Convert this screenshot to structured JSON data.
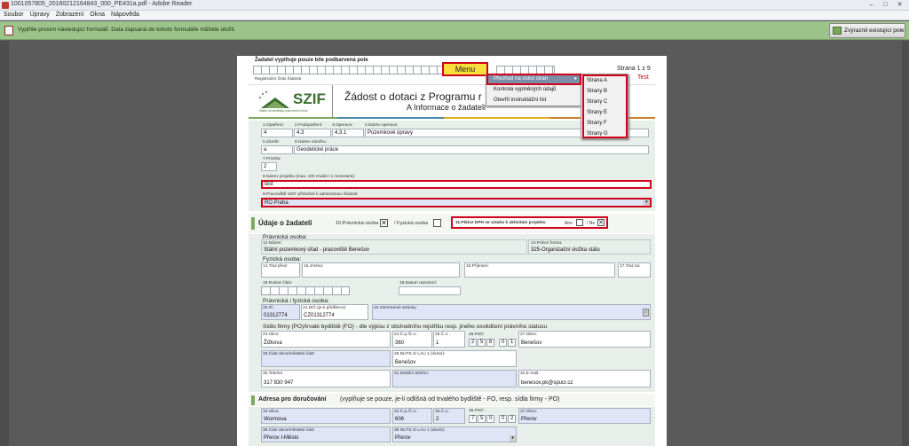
{
  "window": {
    "title": "1001057805_20160212164843_000_PE431a.pdf - Adobe Reader",
    "minimize": "–",
    "maximize": "□",
    "close": "✕"
  },
  "menubar": [
    "Soubor",
    "Úpravy",
    "Zobrazení",
    "Okna",
    "Nápověda"
  ],
  "notification": {
    "text": "Vyplňte prosím následující formulář. Data zapsaná do tohoto formuláře můžete uložit.",
    "highlight_button": "Zvýraznit existující pole"
  },
  "form": {
    "top_note": "Žadatel vyplňuje pouze bíle podbarvená pole",
    "reg_label": "Registrační číslo žádosti",
    "page_label": "Strana 1 z 9",
    "test_label": "Test",
    "menu_button": "Menu",
    "logo_text": "SZIF",
    "logo_sub": "Státní zemědělský intervenční fond",
    "title_line1": "Žádost o dotaci z Programu r",
    "title_line2": "A Informace o žadateli",
    "context_menu": [
      "Přechod na oskci stran",
      "Kontrola vyplněných údajů",
      "Otevřít instruktážní list"
    ],
    "submenu": [
      "Strana A",
      "Strany B",
      "Strany C",
      "Strany E",
      "Strany F",
      "Strany G"
    ],
    "f1_label": "1.Opatření:",
    "f1_value": "4",
    "f2_label": "2.Podopatření:",
    "f2_value": "4.3",
    "f3_label": "3.Operace:",
    "f3_value": "4.3.1",
    "f4_label": "4.Název operace:",
    "f4_value": "Pozemkové úpravy",
    "f5_label": "5.Záměr:",
    "f5_value": "a",
    "f6_label": "6.Název záměru:",
    "f6_value": "Geodetické práce",
    "f7_label": "7.Priorita:",
    "f7_value": "2",
    "f8_label": "8.Název projektu (max. 100 znaků i s mezerami):",
    "f8_value": "test",
    "f9_label": "9.Pracoviště SZIF příslušné k administraci žádosti:",
    "f9_value": "RO Praha",
    "applicant_header": "Údaje o žadateli",
    "f10_label": "10.Právnická osoba",
    "fo_label": "/ Fyzická osoba",
    "f11_label": "11.Plátce DPH ve vztahu k aktivitám projektu",
    "ano": "Ano",
    "ne": "/ Ne",
    "po_header": "Právnická osoba:",
    "f12_label": "12.Název:",
    "f12_value": "Státní pozemkový úřad - pracoviště Benešov",
    "f13_label": "13.Právní forma:",
    "f13_value": "325-Organizační složka státu",
    "fo_header": "Fyzická osoba:",
    "f14_label": "14.Titul před:",
    "f15_label": "15.Jméno:",
    "f16_label": "16.Příjmení:",
    "f17_label": "17.Titul za:",
    "f18_label": "18.Rodné číslo:",
    "f19_label": "19.Datum narození:",
    "pfo_header": "Právnická i fyzická osoba:",
    "f20_label": "20.IČ:",
    "f20_value": "01312774",
    "f21_label": "21.DIČ (je-li přiděleno):",
    "f21_value": "CZ01312774",
    "f22_label": "22.Internetové stránky:",
    "sidlo_header": "Sídlo firmy (PO)/trvalé bydliště (FO) - dle výpisu z obchodního rejstříku resp. jiného osvědčení právního statusu",
    "f23_label": "23.Ulice:",
    "f23_value": "Žižkova",
    "f24_label": "24.Č.p./Č.e.:",
    "f24_value": "360",
    "f25_label": "25.Č.o.:",
    "f25_value": "1",
    "f26_label": "26.PSČ:",
    "f26_digits": [
      "2",
      "5",
      "6",
      "0",
      "1"
    ],
    "f27_label": "27.Obec:",
    "f27_value": "Benešov",
    "f28_label": "28.Část obce/městská část:",
    "f29_label": "29.NUTS 4/ LAU 1 (okres):",
    "f29_value": "Benešov",
    "f30_label": "30.Telefon:",
    "f30_value": "317 830 947",
    "f31_label": "31.Mobilní telefon:",
    "f32_label": "32.E-mail:",
    "f32_value": "benesov.pk@spucr.cz",
    "addr_header": "Adresa pro doručování",
    "addr_note": "(vyplňuje se pouze, je-li odlišná od trvalého bydliště - FO, resp. sídla firmy - PO)",
    "f33_label": "33.Ulice:",
    "f33_value": "Wurmova",
    "f34_label": "34.Č.p./Č.e.:",
    "f34_value": "606",
    "f35_label": "35.Č.o.:",
    "f35_value": "2",
    "f36_label": "36.PSČ:",
    "f36_digits": [
      "7",
      "5",
      "0",
      "0",
      "2"
    ],
    "f37_label": "37.Obec:",
    "f37_value": "Přerov",
    "f38_label": "38.Část obce/městská část:",
    "f38_value": "Přerov I-Město",
    "f39_label": "39.NUTS 4/ LAU 1 (okres):",
    "f39_value": "Přerov"
  }
}
